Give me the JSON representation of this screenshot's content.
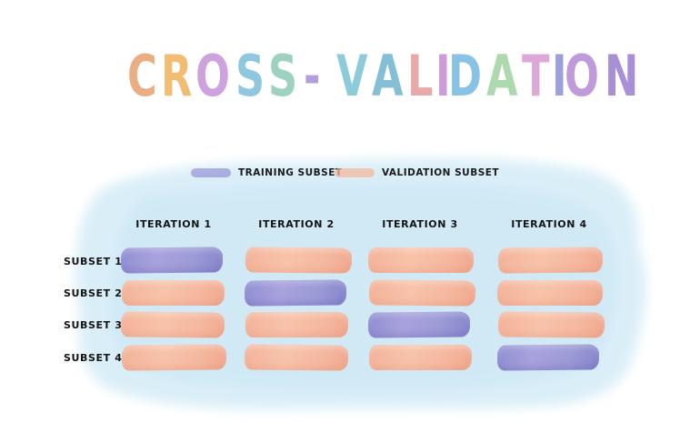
{
  "title": "CROSS-VALIDATION",
  "title_colors": [
    "#e7a070",
    "#f0b15a",
    "#c592d8",
    "#7cbfd9",
    "#8cc9b8",
    "#a78ed8",
    "#79c4d4",
    "#6fb5cf",
    "#e69b9b",
    "#c58ad4",
    "#74b8e0",
    "#9fd3a0",
    "#d79ad2",
    "#8e8fd8",
    "#b48ad6",
    "#9a7ccf"
  ],
  "legend": {
    "training_label": "TRAINING SUBSET",
    "validation_label": "VALIDATION SUBSET"
  },
  "colors": {
    "training": "#9a98d6",
    "validation": "#f5b89e",
    "wash": "#d6edf7"
  },
  "columns": [
    "ITERATION 1",
    "ITERATION 2",
    "ITERATION 3",
    "ITERATION 4"
  ],
  "rows": [
    "SUBSET 1",
    "SUBSET 2",
    "SUBSET 3",
    "SUBSET 4"
  ],
  "grid": [
    [
      "training",
      "validation",
      "validation",
      "validation"
    ],
    [
      "validation",
      "training",
      "validation",
      "validation"
    ],
    [
      "validation",
      "validation",
      "training",
      "validation"
    ],
    [
      "validation",
      "validation",
      "validation",
      "training"
    ]
  ]
}
